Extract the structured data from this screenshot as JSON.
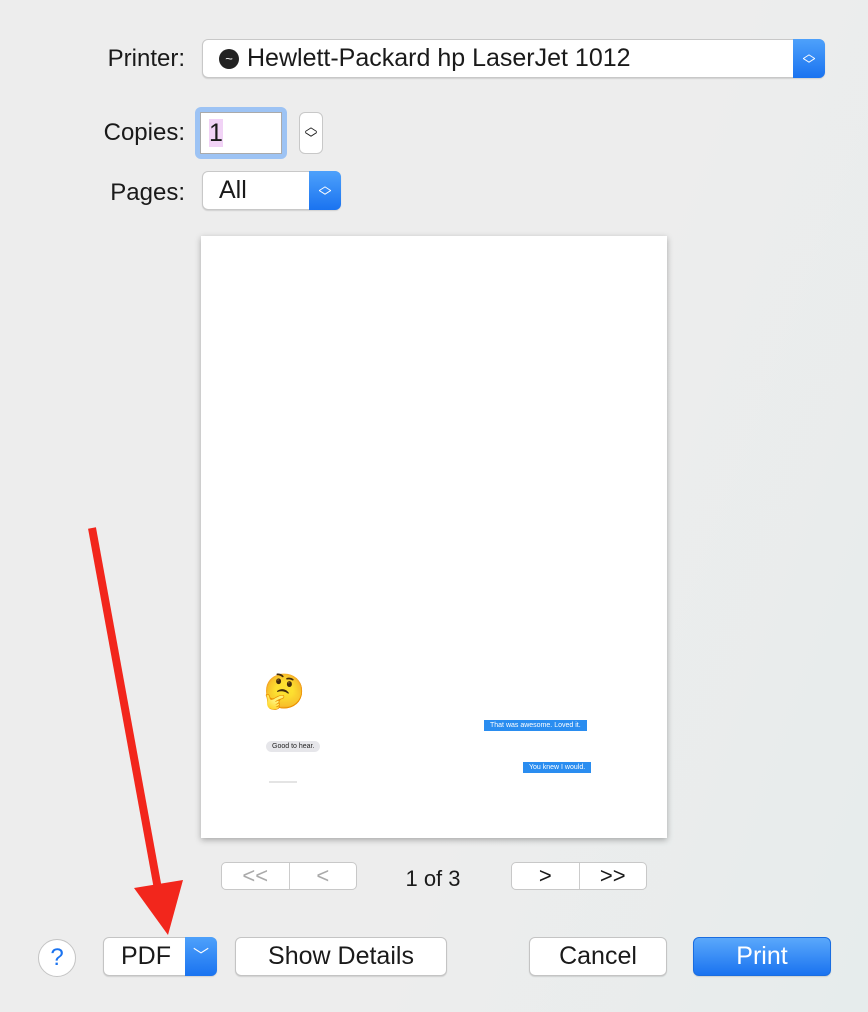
{
  "printer": {
    "label": "Printer:",
    "value": "Hewlett-Packard hp LaserJet 1012",
    "icon": "printer-status-icon"
  },
  "copies": {
    "label": "Copies:",
    "value": "1"
  },
  "pages": {
    "label": "Pages:",
    "value": "All"
  },
  "preview": {
    "emoji": "🤔",
    "messages": [
      {
        "text": "That was awesome. Loved it.",
        "side": "right"
      },
      {
        "text": "Good to hear.",
        "side": "left"
      },
      {
        "text": "You knew I would.",
        "side": "right"
      }
    ]
  },
  "pager": {
    "first": "<<",
    "prev": "<",
    "status": "1 of 3",
    "next": ">",
    "last": ">>"
  },
  "footer": {
    "help": "?",
    "pdf": "PDF",
    "show_details": "Show Details",
    "cancel": "Cancel",
    "print": "Print"
  },
  "colors": {
    "accent": "#1a73f0",
    "annotation_arrow": "#f2261c"
  }
}
